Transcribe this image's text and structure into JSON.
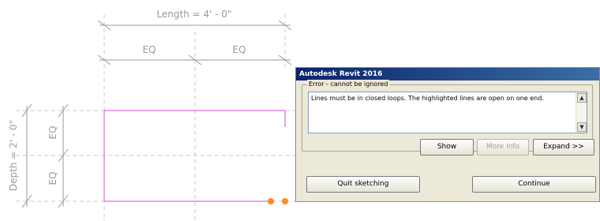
{
  "drawing": {
    "length_label": "Length = 4' - 0\"",
    "depth_label": "Depth = 2' - 0\"",
    "eq_labels_top": [
      "EQ",
      "EQ"
    ],
    "eq_labels_left": [
      "EQ",
      "EQ"
    ],
    "colors": {
      "dimension": "#9a9a9a",
      "sketch_line": "#d24cd2",
      "grip": "#ff8c1a"
    }
  },
  "dialog": {
    "title": "Autodesk Revit 2016",
    "group_label": "Error - cannot be ignored",
    "message": "Lines must be in closed loops. The highlighted lines are open on one end.",
    "buttons": {
      "show": "Show",
      "more_info": "More Info",
      "expand": "Expand >>",
      "quit": "Quit sketching",
      "continue": "Continue"
    },
    "icons": {
      "scroll_up": "▲",
      "scroll_down": "▼"
    }
  }
}
